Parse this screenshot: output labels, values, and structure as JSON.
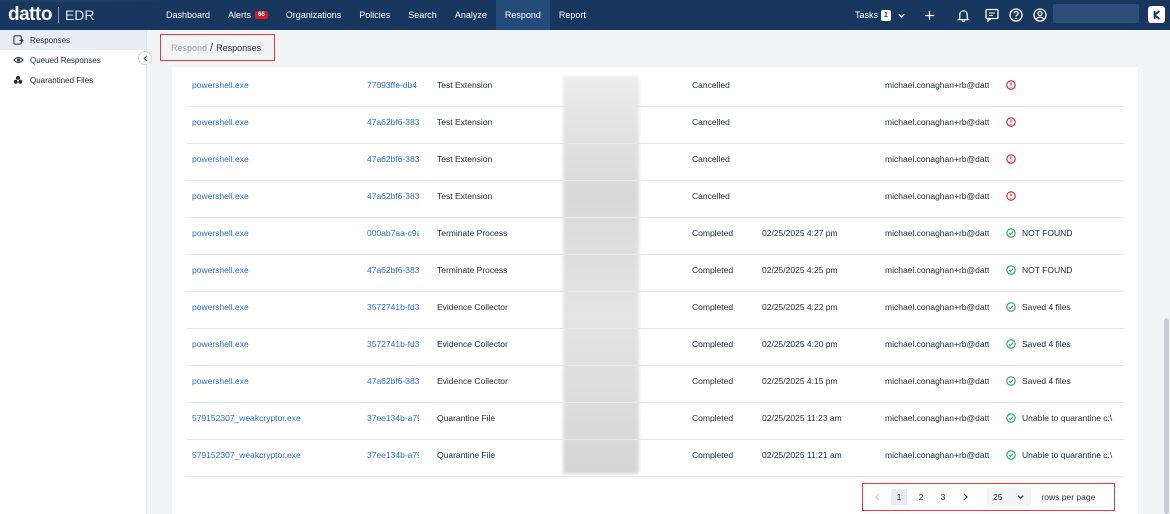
{
  "brand": {
    "logo": "datto",
    "product": "EDR"
  },
  "nav": {
    "items": [
      {
        "label": "Dashboard"
      },
      {
        "label": "Alerts",
        "badge": "66"
      },
      {
        "label": "Organizations"
      },
      {
        "label": "Policies"
      },
      {
        "label": "Search"
      },
      {
        "label": "Analyze"
      },
      {
        "label": "Respond",
        "active": true
      },
      {
        "label": "Report"
      }
    ]
  },
  "tools": {
    "tasks_label": "Tasks",
    "tasks_count": "1"
  },
  "sidebar": {
    "items": [
      {
        "label": "Responses",
        "icon": "responses-icon"
      },
      {
        "label": "Queued Responses",
        "icon": "eye-icon"
      },
      {
        "label": "Quarantined Files",
        "icon": "biohazard-icon"
      }
    ]
  },
  "breadcrumb": {
    "parent": "Respond",
    "separator": "/",
    "current": "Responses"
  },
  "rows": [
    {
      "file": "powershell.exe",
      "id": "77093ffe-db4",
      "type": "Test Extension",
      "status": "Cancelled",
      "date": "",
      "user": "michael.conaghan+rb@datt",
      "result": "",
      "result_kind": "error"
    },
    {
      "file": "powershell.exe",
      "id": "47a62bf6-383",
      "type": "Test Extension",
      "status": "Cancelled",
      "date": "",
      "user": "michael.conaghan+rb@datt",
      "result": "",
      "result_kind": "error"
    },
    {
      "file": "powershell.exe",
      "id": "47a62bf6-383",
      "type": "Test Extension",
      "status": "Cancelled",
      "date": "",
      "user": "michael.conaghan+rb@datt",
      "result": "",
      "result_kind": "error"
    },
    {
      "file": "powershell.exe",
      "id": "47a62bf6-383",
      "type": "Test Extension",
      "status": "Cancelled",
      "date": "",
      "user": "michael.conaghan+rb@datt",
      "result": "",
      "result_kind": "error"
    },
    {
      "file": "powershell.exe",
      "id": "000ab7aa-c9a",
      "type": "Terminate Process",
      "status": "Completed",
      "date": "02/25/2025 4:27 pm",
      "user": "michael.conaghan+rb@datt",
      "result": "NOT FOUND",
      "result_kind": "ok"
    },
    {
      "file": "powershell.exe",
      "id": "47a62bf6-383",
      "type": "Terminate Process",
      "status": "Completed",
      "date": "02/25/2025 4:25 pm",
      "user": "michael.conaghan+rb@datt",
      "result": "NOT FOUND",
      "result_kind": "ok"
    },
    {
      "file": "powershell.exe",
      "id": "3572741b-fd3",
      "type": "Evidence Collector",
      "status": "Completed",
      "date": "02/25/2025 4:22 pm",
      "user": "michael.conaghan+rb@datt",
      "result": "Saved 4 files",
      "result_kind": "ok"
    },
    {
      "file": "powershell.exe",
      "id": "3572741b-fd3",
      "type": "Evidence Collector",
      "status": "Completed",
      "date": "02/25/2025 4:20 pm",
      "user": "michael.conaghan+rb@datt",
      "result": "Saved 4 files",
      "result_kind": "ok"
    },
    {
      "file": "powershell.exe",
      "id": "47a62bf6-383",
      "type": "Evidence Collector",
      "status": "Completed",
      "date": "02/25/2025 4:15 pm",
      "user": "michael.conaghan+rb@datt",
      "result": "Saved 4 files",
      "result_kind": "ok"
    },
    {
      "file": "579152307_weakcryptor.exe",
      "id": "37ee134b-a79",
      "type": "Quarantine File",
      "status": "Completed",
      "date": "02/25/2025 11:23 am",
      "user": "michael.conaghan+rb@datt",
      "result": "Unable to quarantine c:\\",
      "result_kind": "ok"
    },
    {
      "file": "579152307_weakcryptor.exe",
      "id": "37ee134b-a79",
      "type": "Quarantine File",
      "status": "Completed",
      "date": "02/25/2025 11:21 am",
      "user": "michael.conaghan+rb@datt",
      "result": "Unable to quarantine c:\\",
      "result_kind": "ok"
    }
  ],
  "pagination": {
    "pages": [
      "1",
      "2",
      "3"
    ],
    "current": "1",
    "rows_per_page": "25",
    "rows_per_page_label": "rows per page"
  },
  "colors": {
    "topbar": "#17375e",
    "link": "#2b6fd6",
    "error": "#d11d2b",
    "success": "#22a35a",
    "highlight": "#e33b3b"
  }
}
